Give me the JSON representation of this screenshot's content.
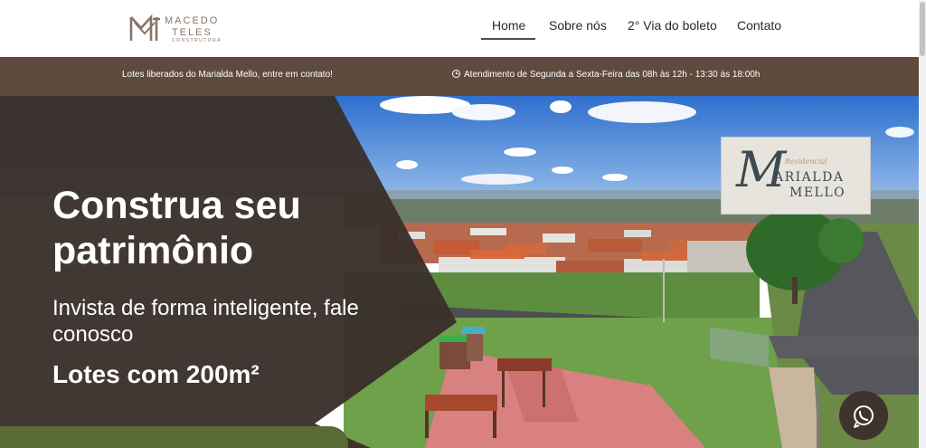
{
  "header": {
    "logo": {
      "line1": "MACEDO",
      "line2": "TELES",
      "line3": "CONSTRUTORA",
      "icon": "macedo-teles-logo-mark"
    },
    "nav": [
      {
        "label": "Home",
        "active": true
      },
      {
        "label": "Sobre nós",
        "active": false
      },
      {
        "label": "2° Via do boleto",
        "active": false
      },
      {
        "label": "Contato",
        "active": false
      }
    ]
  },
  "info_bar": {
    "announcement": "Lotes liberados do Marialda Mello, entre em contato!",
    "hours": "Atendimento de Segunda a Sexta-Feira das 08h às 12h - 13:30 às 18:00h",
    "hours_icon": "clock-icon"
  },
  "hero": {
    "title": "Construa seu patrimônio",
    "subtitle": "Invista de forma inteligente, fale conosco",
    "lots": "Lotes com 200m²",
    "sign": {
      "residencial": "Residencial",
      "initial": "M",
      "line1": "ARIALDA",
      "line2": "MELLO"
    }
  },
  "whatsapp": {
    "icon": "whatsapp-icon"
  },
  "colors": {
    "accent_brown": "#5e4b3e",
    "overlay_dark": "#3a302b",
    "logo": "#8a7266",
    "green": "#5a6a36"
  }
}
